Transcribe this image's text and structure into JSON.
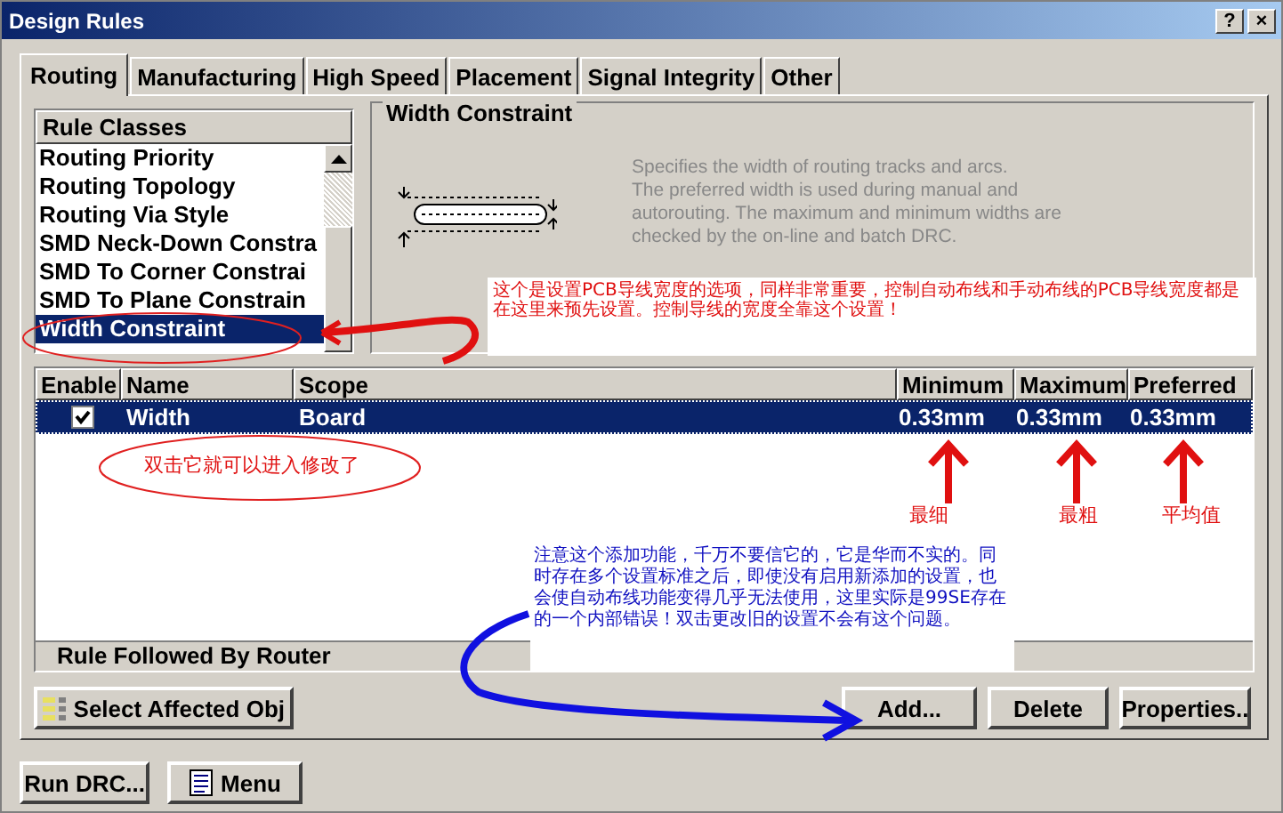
{
  "window": {
    "title": "Design Rules",
    "buttons": [
      "?",
      "×"
    ]
  },
  "tabs": [
    {
      "label": "Routing",
      "selected": true
    },
    {
      "label": "Manufacturing",
      "selected": false
    },
    {
      "label": "High Speed",
      "selected": false
    },
    {
      "label": "Placement",
      "selected": false
    },
    {
      "label": "Signal Integrity",
      "selected": false
    },
    {
      "label": "Other",
      "selected": false
    }
  ],
  "rule_classes": {
    "header": "Rule Classes",
    "items": [
      {
        "label": "Routing Priority",
        "selected": false
      },
      {
        "label": "Routing Topology",
        "selected": false
      },
      {
        "label": "Routing Via Style",
        "selected": false
      },
      {
        "label": "SMD Neck-Down Constra",
        "selected": false
      },
      {
        "label": "SMD To Corner Constrai",
        "selected": false
      },
      {
        "label": "SMD To Plane Constrain",
        "selected": false
      },
      {
        "label": "Width Constraint",
        "selected": true
      }
    ]
  },
  "description": {
    "title": "Width Constraint",
    "lines": [
      "Specifies the width of routing tracks and arcs.",
      "The preferred width is used during manual and",
      "autorouting. The maximum and minimum widths are",
      "checked by the on-line and batch DRC."
    ]
  },
  "rules_table": {
    "columns": [
      "Enable",
      "Name",
      "Scope",
      "Minimum",
      "Maximum",
      "Preferred"
    ],
    "rows": [
      {
        "enabled": true,
        "selected": true,
        "cells": [
          "",
          "Width",
          "Board",
          "0.33mm",
          "0.33mm",
          "0.33mm"
        ]
      }
    ],
    "footer": "Rule Followed By Router"
  },
  "buttons": [
    "Select Affected Obj",
    "Add...",
    "Delete",
    "Properties.."
  ],
  "bottom_buttons": [
    "Run DRC...",
    "Menu"
  ],
  "notes": {
    "class_note": "这个是设置PCB导线宽度的选项，同样非常重要，控制自动布线和手动布线的PCB导线宽度都是在这里来预先设置。控制导线的宽度全靠这个设置！",
    "double_click": "双击它就可以进入修改了",
    "labels": [
      "最细",
      "最粗",
      "平均值"
    ],
    "add_warning": "注意这个添加功能，千万不要信它的，它是华而不实的。同时存在多个设置标准之后，即使没有启用新添加的设置，也会使自动布线功能变得几乎无法使用，这里实际是99SE存在的一个内部错误！双击更改旧的设置不会有这个问题。"
  }
}
